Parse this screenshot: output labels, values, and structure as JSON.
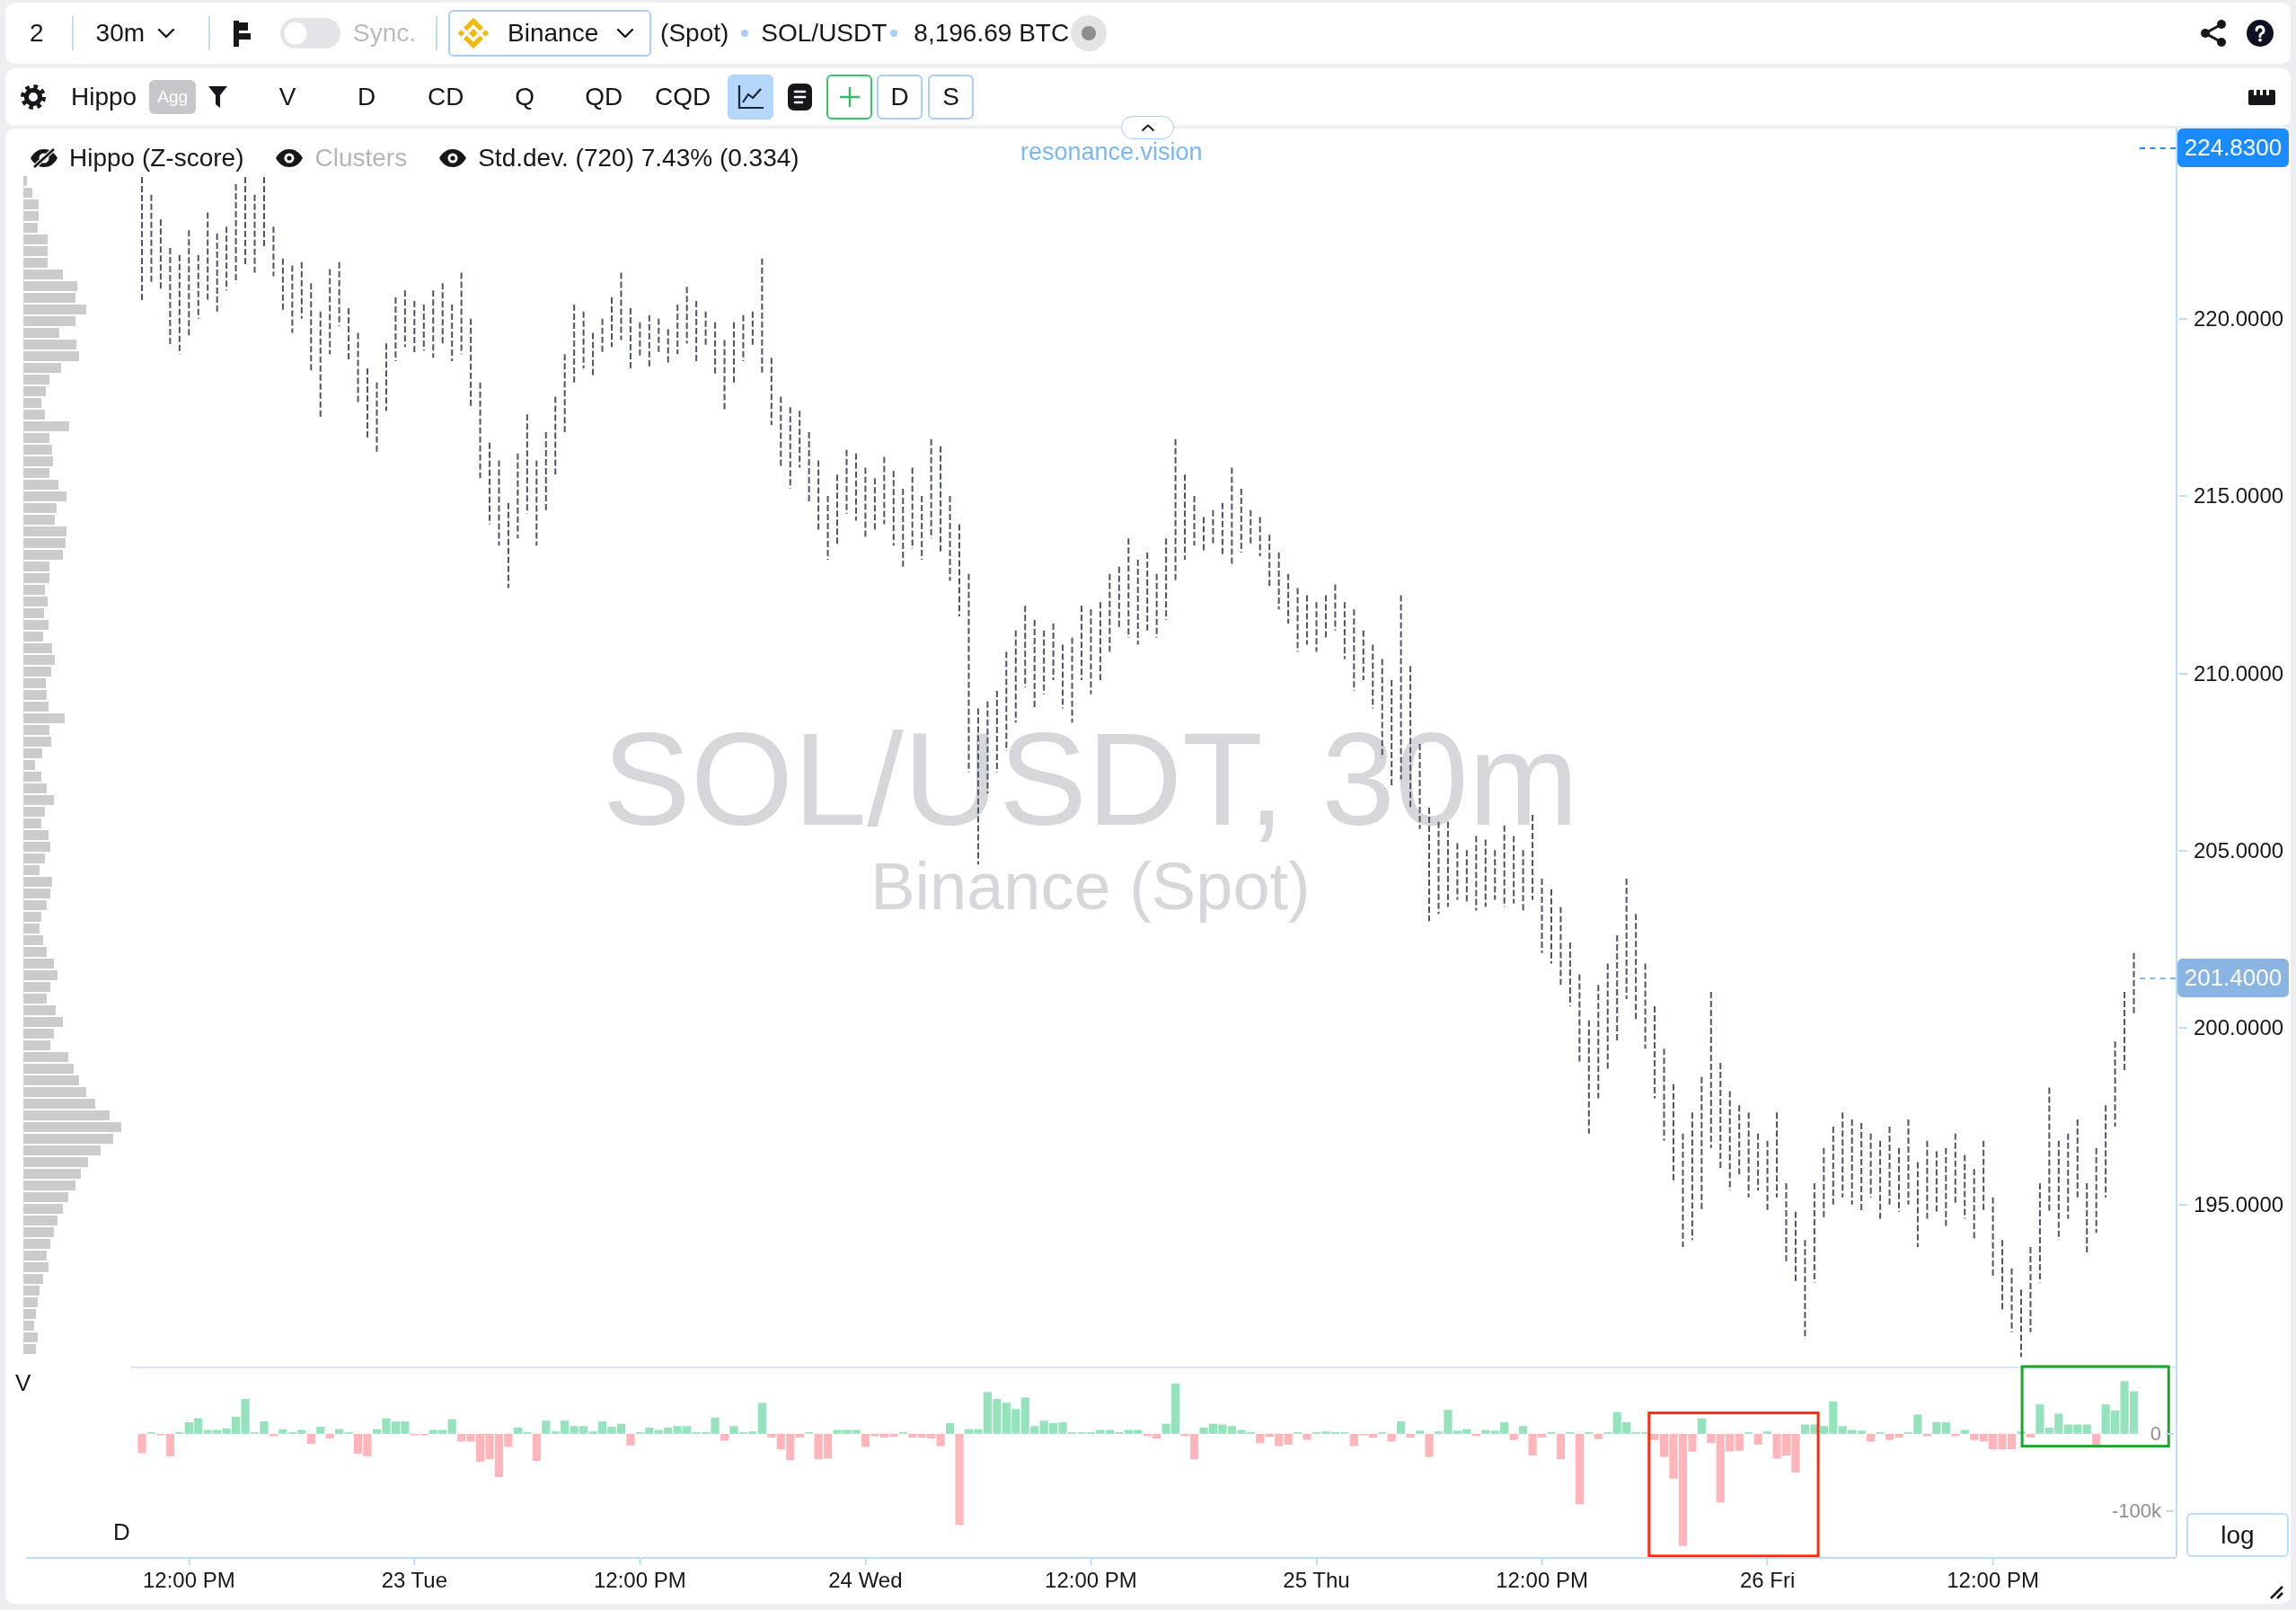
{
  "top_toolbar": {
    "layout_count": "2",
    "interval": "30m",
    "sync": {
      "label": "Sync.",
      "on": false
    },
    "exchange": "Binance",
    "market": "(Spot)",
    "pair": "SOL/USDT",
    "volume": "8,196.69 BTC"
  },
  "indicator_toolbar": {
    "indicator": "Hippo",
    "badge": "Agg",
    "series_buttons": [
      "V",
      "D",
      "CD",
      "Q",
      "QD",
      "CQD"
    ],
    "line_view": {
      "selected": true
    },
    "panel_buttons": [
      "D",
      "S"
    ]
  },
  "chart": {
    "legend": [
      {
        "label": "Hippo (Z-score)",
        "visible": false,
        "disabled": false
      },
      {
        "label": "Clusters",
        "visible": true,
        "disabled": true
      },
      {
        "label": "Std.dev. (720) 7.43% (0.334)",
        "visible": true,
        "disabled": false
      }
    ],
    "brand": "resonance.vision",
    "watermark": {
      "title": "SOL/USDT, 30m",
      "subtitle": "Binance (Spot)"
    },
    "volume_profile": {
      "label": "V"
    },
    "price_pane": {
      "axis_labels": [
        "220.0000",
        "215.0000",
        "210.0000",
        "205.0000",
        "200.0000",
        "195.0000"
      ],
      "markers": [
        {
          "kind": "high",
          "label": "224.8300",
          "color": "#1a8cff"
        },
        {
          "kind": "last",
          "label": "201.4000",
          "color": "#8ab4e2"
        }
      ]
    },
    "delta_pane": {
      "label": "D",
      "highlights": [
        {
          "color": "#ff2a14"
        },
        {
          "color": "#1fa52d"
        }
      ],
      "chart_data": {
        "type": "bar",
        "ylim": [
          -159300,
          87000
        ],
        "yticks": [
          {
            "value": 0,
            "label": "0"
          },
          {
            "value": -100000,
            "label": "-100k"
          }
        ],
        "categories": [
          null,
          null,
          null,
          null,
          null,
          "12:00 PM",
          null,
          null,
          null,
          null,
          null,
          null,
          null,
          null,
          null,
          null,
          null,
          null,
          null,
          null,
          null,
          null,
          null,
          null,
          null,
          null,
          null,
          null,
          null,
          "23 Tue",
          null,
          null,
          null,
          null,
          null,
          null,
          null,
          null,
          null,
          null,
          null,
          null,
          null,
          null,
          null,
          null,
          null,
          null,
          null,
          null,
          null,
          null,
          null,
          "12:00 PM",
          null,
          null,
          null,
          null,
          null,
          null,
          null,
          null,
          null,
          null,
          null,
          null,
          null,
          null,
          null,
          null,
          null,
          null,
          null,
          null,
          null,
          null,
          null,
          "24 Wed",
          null,
          null,
          null,
          null,
          null,
          null,
          null,
          null,
          null,
          null,
          null,
          null,
          null,
          null,
          null,
          null,
          null,
          null,
          null,
          null,
          null,
          null,
          null,
          "12:00 PM",
          null,
          null,
          null,
          null,
          null,
          null,
          null,
          null,
          null,
          null,
          null,
          null,
          null,
          null,
          null,
          null,
          null,
          null,
          null,
          null,
          null,
          null,
          null,
          "25 Thu",
          null,
          null,
          null,
          null,
          null,
          null,
          null,
          null,
          null,
          null,
          null,
          null,
          null,
          null,
          null,
          null,
          null,
          null,
          null,
          null,
          null,
          null,
          null,
          "12:00 PM",
          null,
          null,
          null,
          null,
          null,
          null,
          null,
          null,
          null,
          null,
          null,
          null,
          null,
          null,
          null,
          null,
          null,
          null,
          null,
          null,
          null,
          null,
          null,
          "26 Fri",
          null,
          null,
          null,
          null,
          null,
          null,
          null,
          null,
          null,
          null,
          null,
          null,
          null,
          null,
          null,
          null,
          null,
          null,
          null,
          null,
          null,
          null,
          null,
          "12:00 PM",
          null,
          null,
          null,
          null,
          null,
          null,
          null,
          null,
          null,
          null,
          null,
          null,
          null,
          null,
          null
        ],
        "values": [
          -25000,
          2000,
          -2000,
          -29000,
          2000,
          15000,
          20000,
          5000,
          5000,
          7000,
          22000,
          45000,
          2000,
          16000,
          -3000,
          6000,
          2000,
          5000,
          -13000,
          9000,
          -6000,
          6000,
          2000,
          -26000,
          -29000,
          6000,
          20000,
          16000,
          16000,
          -2000,
          -2000,
          5000,
          5000,
          19000,
          -10000,
          -10000,
          -36000,
          -33000,
          -56000,
          -17000,
          8000,
          2000,
          -35000,
          17000,
          3000,
          17000,
          10000,
          10000,
          3000,
          16000,
          9000,
          13000,
          -15000,
          2000,
          8000,
          5000,
          8000,
          10000,
          10000,
          2000,
          2000,
          21000,
          -9000,
          10000,
          2000,
          3000,
          40000,
          -5000,
          -20000,
          -34000,
          -5000,
          2000,
          -33000,
          -32000,
          5000,
          5000,
          5000,
          -17000,
          -3000,
          -5000,
          -4000,
          2000,
          -5000,
          -5000,
          -6000,
          -16000,
          14000,
          -118000,
          6000,
          6000,
          54000,
          45000,
          40000,
          32000,
          47000,
          10000,
          17000,
          14000,
          15000,
          2000,
          2000,
          2000,
          5000,
          5000,
          2000,
          5000,
          5000,
          -3000,
          -6000,
          13000,
          65000,
          -3000,
          -33000,
          8000,
          13000,
          12000,
          10000,
          5000,
          2000,
          -12000,
          -4000,
          -16000,
          -14000,
          2000,
          -8000,
          2000,
          3000,
          2000,
          2000,
          -16000,
          -2000,
          -5000,
          2000,
          -10000,
          16000,
          -5000,
          4000,
          -30000,
          3000,
          31000,
          4000,
          6000,
          -3000,
          5000,
          4000,
          15000,
          -8000,
          10000,
          -28000,
          -5000,
          2000,
          -33000,
          2000,
          -91000,
          2000,
          -7000,
          2000,
          28000,
          15000,
          2000,
          2000,
          -8000,
          -30000,
          -58000,
          -145000,
          -23000,
          20000,
          -12000,
          -89000,
          -23000,
          -22000,
          2000,
          -14000,
          3000,
          -32000,
          -28000,
          -50000,
          12000,
          12000,
          10000,
          42000,
          10000,
          5000,
          4000,
          -10000,
          2000,
          -8000,
          -5000,
          2000,
          25000,
          -3000,
          15000,
          15000,
          -3000,
          5000,
          -8000,
          -10000,
          -20000,
          -20000,
          -20000,
          3000,
          -5000,
          38000,
          8000,
          26000,
          12000,
          12000,
          12000,
          -15000,
          38000,
          30000,
          68000,
          55000
        ]
      }
    },
    "scale_button": "log"
  }
}
